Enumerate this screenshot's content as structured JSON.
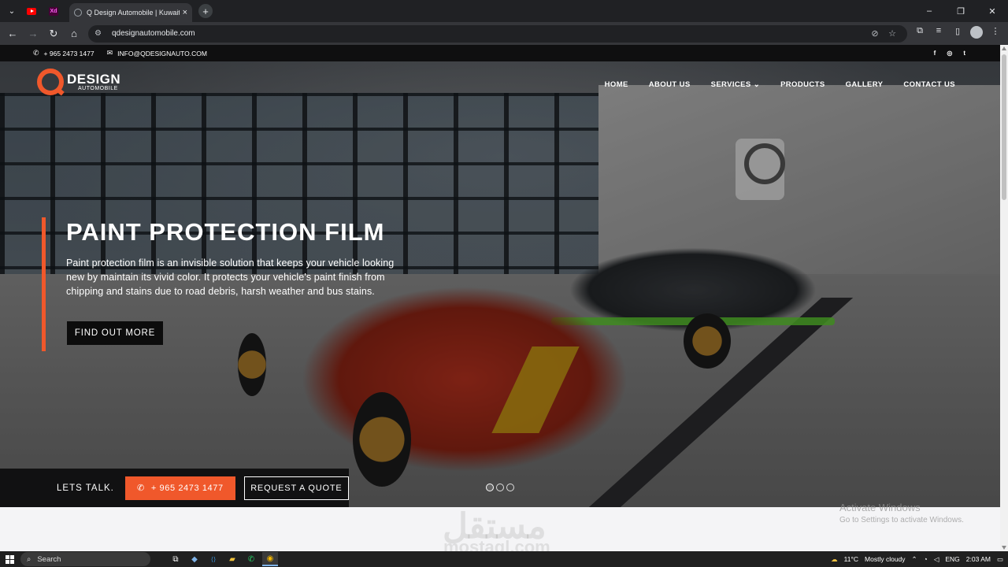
{
  "browser": {
    "tab_title": "Q Design Automobile | Kuwait's",
    "tab_close": "×",
    "new_tab": "+",
    "tab_search": "⌄",
    "pinned_tabs": [
      {
        "name": "youtube",
        "icon": "youtube-icon"
      },
      {
        "name": "adobe-xd",
        "icon": "xd-icon",
        "label": "Xd"
      }
    ],
    "window_controls": {
      "minimize": "–",
      "restore": "❐",
      "close": "✕"
    },
    "nav": {
      "back": "←",
      "forward": "→",
      "reload": "↻",
      "home": "⌂"
    },
    "url": "qdesignautomobile.com",
    "omnibox_icons": [
      "eye-off-icon",
      "star-icon"
    ],
    "toolbar_icons": [
      "extensions-icon",
      "media-icon",
      "sidepanel-icon",
      "profile-icon",
      "menu-icon"
    ],
    "menu_glyph": "⋮"
  },
  "site": {
    "topbar": {
      "phone_icon": "✆",
      "phone": "+ 965 2473 1477",
      "mail_icon": "✉",
      "email": "INFO@QDESIGNAUTO.COM",
      "social": [
        {
          "name": "facebook",
          "glyph": "f"
        },
        {
          "name": "instagram",
          "glyph": "◎"
        },
        {
          "name": "twitter",
          "glyph": "t"
        }
      ]
    },
    "logo": {
      "main": "DESIGN",
      "sub": "AUTOMOBILE"
    },
    "menu": [
      "HOME",
      "ABOUT US",
      "SERVICES ⌄",
      "PRODUCTS",
      "GALLERY",
      "CONTACT US"
    ],
    "hero": {
      "title": "PAINT PROTECTION FILM",
      "text": "Paint protection film is an invisible solution that keeps your vehicle looking new by maintain its vivid color. It protects your vehicle's paint finish from chipping and stains due to road debris, harsh weather and bus stains.",
      "button": "FIND OUT MORE",
      "slides": 3,
      "active_slide": 1
    },
    "cta": {
      "lets_talk": "LETS TALK.",
      "phone_icon": "✆",
      "phone": "+ 965 2473 1477",
      "quote": "REQUEST A QUOTE"
    },
    "watermark": {
      "arabic": "مستقل",
      "latin": "mostaql.com"
    }
  },
  "windows_activation": {
    "line1": "Activate Windows",
    "line2": "Go to Settings to activate Windows."
  },
  "taskbar": {
    "search_icon": "⌕",
    "search_label": "Search",
    "apps": [
      {
        "name": "task-view",
        "glyph": "⧉"
      },
      {
        "name": "copilot",
        "glyph": "◆"
      },
      {
        "name": "vscode",
        "glyph": "⟨⟩"
      },
      {
        "name": "file-explorer",
        "glyph": "▰"
      },
      {
        "name": "whatsapp",
        "glyph": "✆"
      },
      {
        "name": "chrome",
        "glyph": "◉",
        "active": true
      }
    ],
    "weather_icon": "☁",
    "weather": "11°C",
    "weather_desc": "Mostly cloudy",
    "tray_chevron": "⌃",
    "language": "ENG",
    "time": "2:03 AM"
  }
}
